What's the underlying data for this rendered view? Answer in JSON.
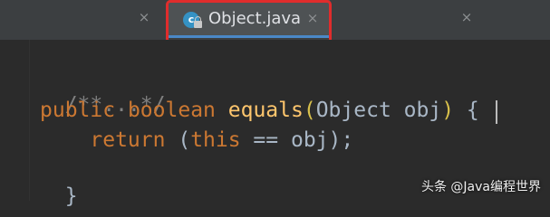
{
  "tabs": [
    {
      "label": "",
      "active": false
    },
    {
      "label": "Object.java",
      "active": true,
      "icon": "class-c-icon",
      "icon_letter": "c"
    },
    {
      "label": "",
      "active": false
    }
  ],
  "close_glyph": "×",
  "editor": {
    "lines": [
      {
        "tokens": [
          "/**...*/"
        ]
      },
      {
        "tokens": [
          "public",
          " ",
          "boolean",
          " ",
          "equals",
          "(",
          "Object obj",
          ")",
          " {"
        ]
      },
      {
        "tokens": [
          "    ",
          "return",
          " (",
          "this",
          " == obj);"
        ]
      },
      {
        "tokens": [
          "}"
        ]
      }
    ]
  },
  "watermark": "头条 @Java编程世界",
  "colors": {
    "keyword": "#cc7832",
    "method": "#ffc66d",
    "comment": "#808080",
    "text": "#a9b7c6",
    "highlight": "#e02c2c",
    "tab_underline": "#4a88c7"
  }
}
